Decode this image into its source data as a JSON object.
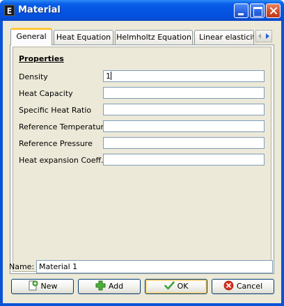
{
  "window": {
    "title": "Material",
    "app_icon_glyph": "E"
  },
  "tabs": [
    {
      "label": "General",
      "active": true
    },
    {
      "label": "Heat Equation",
      "active": false
    },
    {
      "label": "Helmholtz Equation",
      "active": false
    },
    {
      "label": "Linear elasticity",
      "active": false
    }
  ],
  "panel": {
    "section_title": "Properties",
    "fields": [
      {
        "label": "Density",
        "value": "1"
      },
      {
        "label": "Heat Capacity",
        "value": ""
      },
      {
        "label": "Specific Heat Ratio",
        "value": ""
      },
      {
        "label": "Reference Temperature",
        "value": ""
      },
      {
        "label": "Reference Pressure",
        "value": ""
      },
      {
        "label": "Heat expansion Coeff.",
        "value": ""
      }
    ]
  },
  "name": {
    "label": "Name:",
    "value": "Material 1"
  },
  "buttons": {
    "new": "New",
    "add": "Add",
    "ok": "OK",
    "cancel": "Cancel"
  },
  "colors": {
    "titlebar": "#0554e3",
    "face": "#ece9d8",
    "active_tab_accent": "#ffc83c",
    "ok_check": "#3aa53a",
    "cancel_red": "#d9321f",
    "add_green": "#33a02c"
  }
}
